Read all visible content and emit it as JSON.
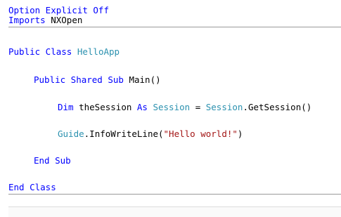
{
  "colors": {
    "keyword": "#0000ff",
    "type": "#2b91af",
    "plain": "#000000",
    "string": "#a31515"
  },
  "code": {
    "lines": [
      {
        "id": "option-explicit-line",
        "tokens": [
          {
            "text": "Option Explicit Off",
            "kind": "keyword"
          }
        ]
      },
      {
        "id": "imports-line",
        "tokens": [
          {
            "text": "Imports",
            "kind": "keyword"
          },
          {
            "text": " NXOpen",
            "kind": "plain"
          }
        ]
      },
      {
        "id": "class-declaration-line",
        "tokens": [
          {
            "text": "Public Class ",
            "kind": "keyword"
          },
          {
            "text": "HelloApp",
            "kind": "type"
          }
        ]
      },
      {
        "id": "sub-declaration-line",
        "tokens": [
          {
            "text": "Public Shared Sub ",
            "kind": "keyword"
          },
          {
            "text": "Main()",
            "kind": "plain"
          }
        ]
      },
      {
        "id": "dim-session-line",
        "tokens": [
          {
            "text": "Dim ",
            "kind": "keyword"
          },
          {
            "text": "theSession ",
            "kind": "plain"
          },
          {
            "text": "As ",
            "kind": "keyword"
          },
          {
            "text": "Session",
            "kind": "type"
          },
          {
            "text": " = ",
            "kind": "plain"
          },
          {
            "text": "Session",
            "kind": "type"
          },
          {
            "text": ".GetSession()",
            "kind": "plain"
          }
        ]
      },
      {
        "id": "info-write-line",
        "tokens": [
          {
            "text": "Guide",
            "kind": "type"
          },
          {
            "text": ".InfoWriteLine(",
            "kind": "plain"
          },
          {
            "text": "\"Hello world!\"",
            "kind": "string"
          },
          {
            "text": ")",
            "kind": "plain"
          }
        ]
      },
      {
        "id": "end-sub-line",
        "tokens": [
          {
            "text": "End Sub",
            "kind": "keyword"
          }
        ]
      },
      {
        "id": "end-class-line",
        "tokens": [
          {
            "text": "End Class",
            "kind": "keyword"
          }
        ]
      }
    ]
  }
}
